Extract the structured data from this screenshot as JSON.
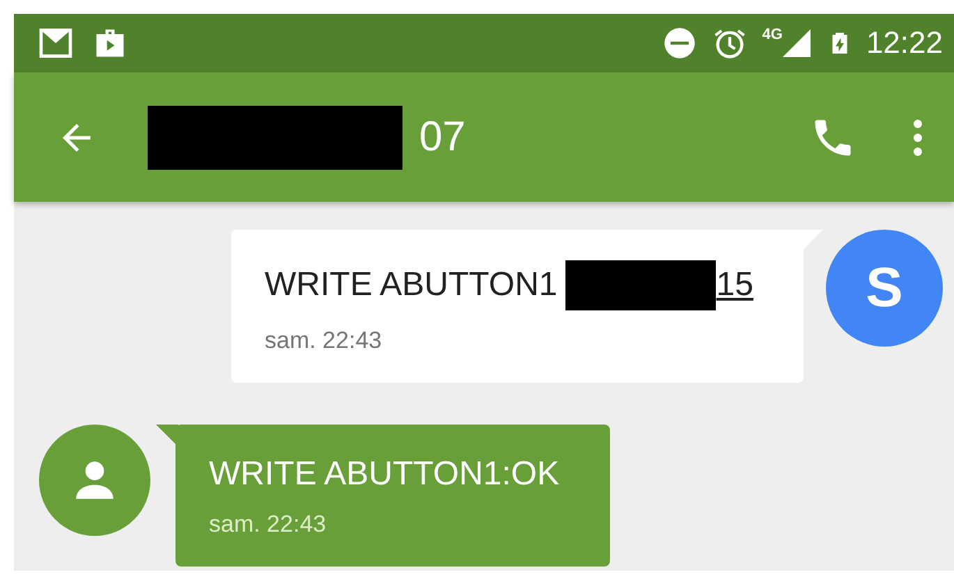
{
  "status_bar": {
    "network": "4G",
    "time": "12:22"
  },
  "app_bar": {
    "title": "07"
  },
  "messages": [
    {
      "kind": "sent",
      "avatar": "S",
      "text": "WRITE ABUTTON1",
      "link": "15",
      "time": "sam. 22:43"
    },
    {
      "kind": "received",
      "text": "WRITE ABUTTON1:OK",
      "time": "sam. 22:43"
    }
  ]
}
